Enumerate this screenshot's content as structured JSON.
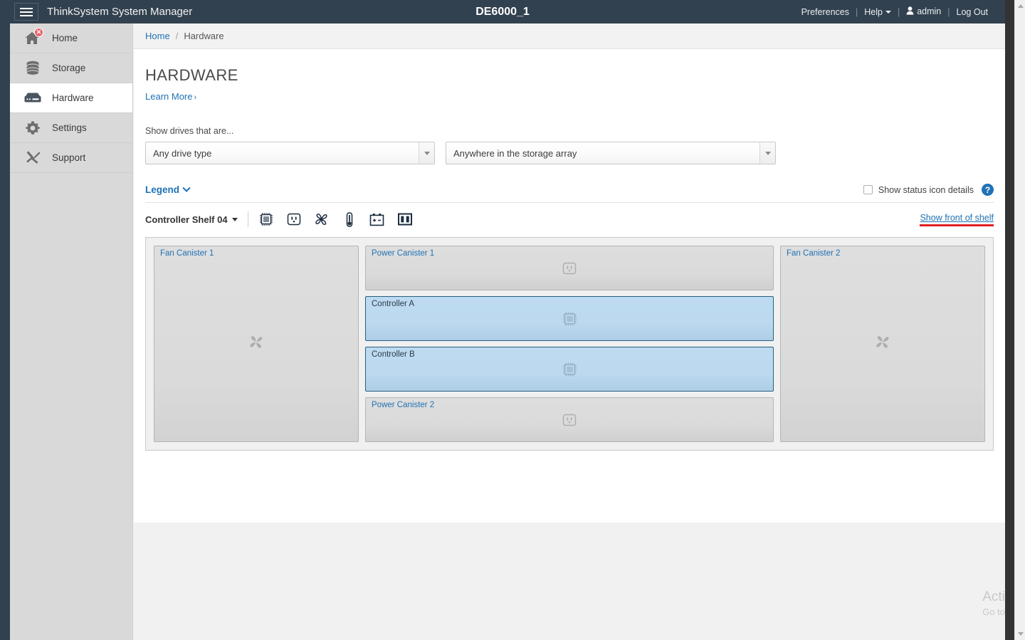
{
  "header": {
    "hamburger_icon": "hamburger-menu-icon",
    "app_title": "ThinkSystem System Manager",
    "system_name": "DE6000_1",
    "preferences_label": "Preferences",
    "help_label": "Help",
    "user_label": "admin",
    "logout_label": "Log Out",
    "separator": "|"
  },
  "sidebar": {
    "items": [
      {
        "label": "Home",
        "icon": "home-icon",
        "active": false,
        "badge": "✕"
      },
      {
        "label": "Storage",
        "icon": "storage-icon",
        "active": false
      },
      {
        "label": "Hardware",
        "icon": "hardware-icon",
        "active": true
      },
      {
        "label": "Settings",
        "icon": "gear-icon",
        "active": false
      },
      {
        "label": "Support",
        "icon": "wrench-hammer-icon",
        "active": false
      }
    ]
  },
  "breadcrumb": {
    "home_label": "Home",
    "separator": "/",
    "current_label": "Hardware"
  },
  "main": {
    "page_title": "HARDWARE",
    "learn_more_label": "Learn More",
    "learn_more_chevron": "›",
    "filter_label": "Show drives that are...",
    "filter_drive_type": "Any drive type",
    "filter_location": "Anywhere in the storage array",
    "legend_label": "Legend",
    "show_status_icon_details_label": "Show status icon details",
    "show_status_icon_details_checked": false,
    "help_badge_label": "?",
    "shelf_selector_label": "Controller Shelf 04",
    "show_front_of_shelf_label": "Show front of shelf",
    "toolbar_icons": [
      "controller-chip-icon",
      "power-outlet-icon",
      "fan-icon",
      "thermometer-icon",
      "battery-icon",
      "cache-memory-icon"
    ]
  },
  "shelf": {
    "left_bay": {
      "label": "Fan Canister 1",
      "icon": "fan-icon"
    },
    "right_bay": {
      "label": "Fan Canister 2",
      "icon": "fan-icon"
    },
    "middle_bays": [
      {
        "label": "Power Canister 1",
        "icon": "power-outlet-icon",
        "type": "power"
      },
      {
        "label": "Controller A",
        "icon": "controller-chip-icon",
        "type": "controller"
      },
      {
        "label": "Controller B",
        "icon": "controller-chip-icon",
        "type": "controller"
      },
      {
        "label": "Power Canister 2",
        "icon": "power-outlet-icon",
        "type": "power"
      }
    ]
  },
  "watermark": {
    "line1": "Acti",
    "line2": "Go to"
  },
  "colors": {
    "header_bg": "#32414f",
    "link_blue": "#1f72b5",
    "controller_fill": "#bcd9ef",
    "controller_border": "#27617f",
    "error_red": "#e8646a",
    "highlight_red": "#e02020",
    "sidebar_bg": "#d9d9d9"
  }
}
